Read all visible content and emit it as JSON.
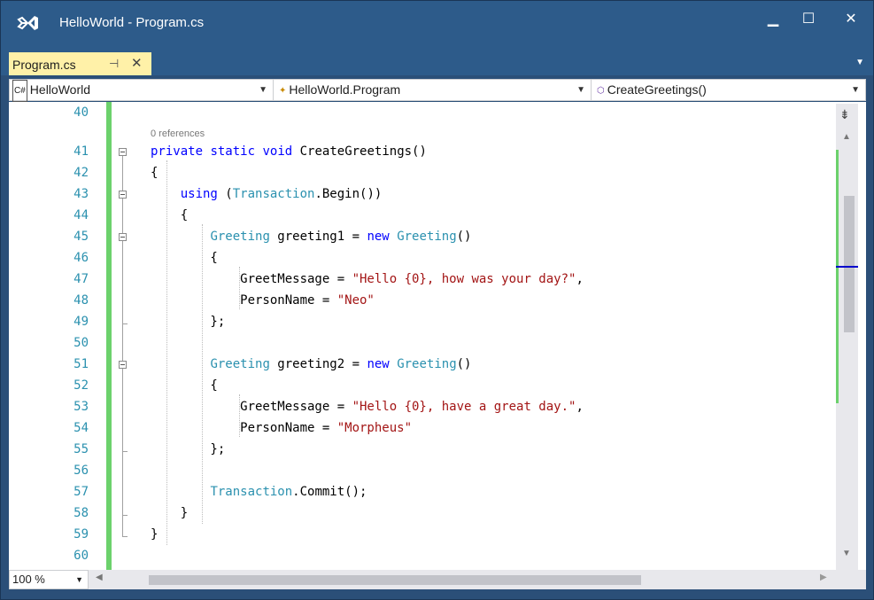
{
  "window": {
    "title": "HelloWorld - Program.cs"
  },
  "controls": {
    "minimize": "▁",
    "maximize": "☐",
    "close": "✕"
  },
  "tab": {
    "label": "Program.cs",
    "pin": "⊣",
    "close": "✕"
  },
  "nav": {
    "project": "HelloWorld",
    "project_icon": "C#",
    "class": "HelloWorld.Program",
    "member": "CreateGreetings()"
  },
  "editor": {
    "references": "0 references",
    "line_numbers": [
      "40",
      "41",
      "42",
      "43",
      "44",
      "45",
      "46",
      "47",
      "48",
      "49",
      "50",
      "51",
      "52",
      "53",
      "54",
      "55",
      "56",
      "57",
      "58",
      "59",
      "60"
    ],
    "lines": [
      [],
      [
        {
          "t": "private",
          "c": "kw"
        },
        {
          "t": " "
        },
        {
          "t": "static",
          "c": "kw"
        },
        {
          "t": " "
        },
        {
          "t": "void",
          "c": "kw"
        },
        {
          "t": " CreateGreetings()"
        }
      ],
      [
        {
          "t": "{"
        }
      ],
      [
        {
          "t": "    "
        },
        {
          "t": "using",
          "c": "kw"
        },
        {
          "t": " ("
        },
        {
          "t": "Transaction",
          "c": "ty"
        },
        {
          "t": ".Begin())"
        }
      ],
      [
        {
          "t": "    {"
        }
      ],
      [
        {
          "t": "        "
        },
        {
          "t": "Greeting",
          "c": "ty"
        },
        {
          "t": " greeting1 = "
        },
        {
          "t": "new",
          "c": "kw"
        },
        {
          "t": " "
        },
        {
          "t": "Greeting",
          "c": "ty"
        },
        {
          "t": "()"
        }
      ],
      [
        {
          "t": "        {"
        }
      ],
      [
        {
          "t": "            GreetMessage = "
        },
        {
          "t": "\"Hello {0}, how was your day?\"",
          "c": "str"
        },
        {
          "t": ","
        }
      ],
      [
        {
          "t": "            PersonName = "
        },
        {
          "t": "\"Neo\"",
          "c": "str"
        }
      ],
      [
        {
          "t": "        };"
        }
      ],
      [],
      [
        {
          "t": "        "
        },
        {
          "t": "Greeting",
          "c": "ty"
        },
        {
          "t": " greeting2 = "
        },
        {
          "t": "new",
          "c": "kw"
        },
        {
          "t": " "
        },
        {
          "t": "Greeting",
          "c": "ty"
        },
        {
          "t": "()"
        }
      ],
      [
        {
          "t": "        {"
        }
      ],
      [
        {
          "t": "            GreetMessage = "
        },
        {
          "t": "\"Hello {0}, have a great day.\"",
          "c": "str"
        },
        {
          "t": ","
        }
      ],
      [
        {
          "t": "            PersonName = "
        },
        {
          "t": "\"Morpheus\"",
          "c": "str"
        }
      ],
      [
        {
          "t": "        };"
        }
      ],
      [],
      [
        {
          "t": "        "
        },
        {
          "t": "Transaction",
          "c": "ty"
        },
        {
          "t": ".Commit();"
        }
      ],
      [
        {
          "t": "    }"
        }
      ],
      [
        {
          "t": "}"
        }
      ],
      []
    ]
  },
  "status": {
    "zoom": "100 %"
  }
}
